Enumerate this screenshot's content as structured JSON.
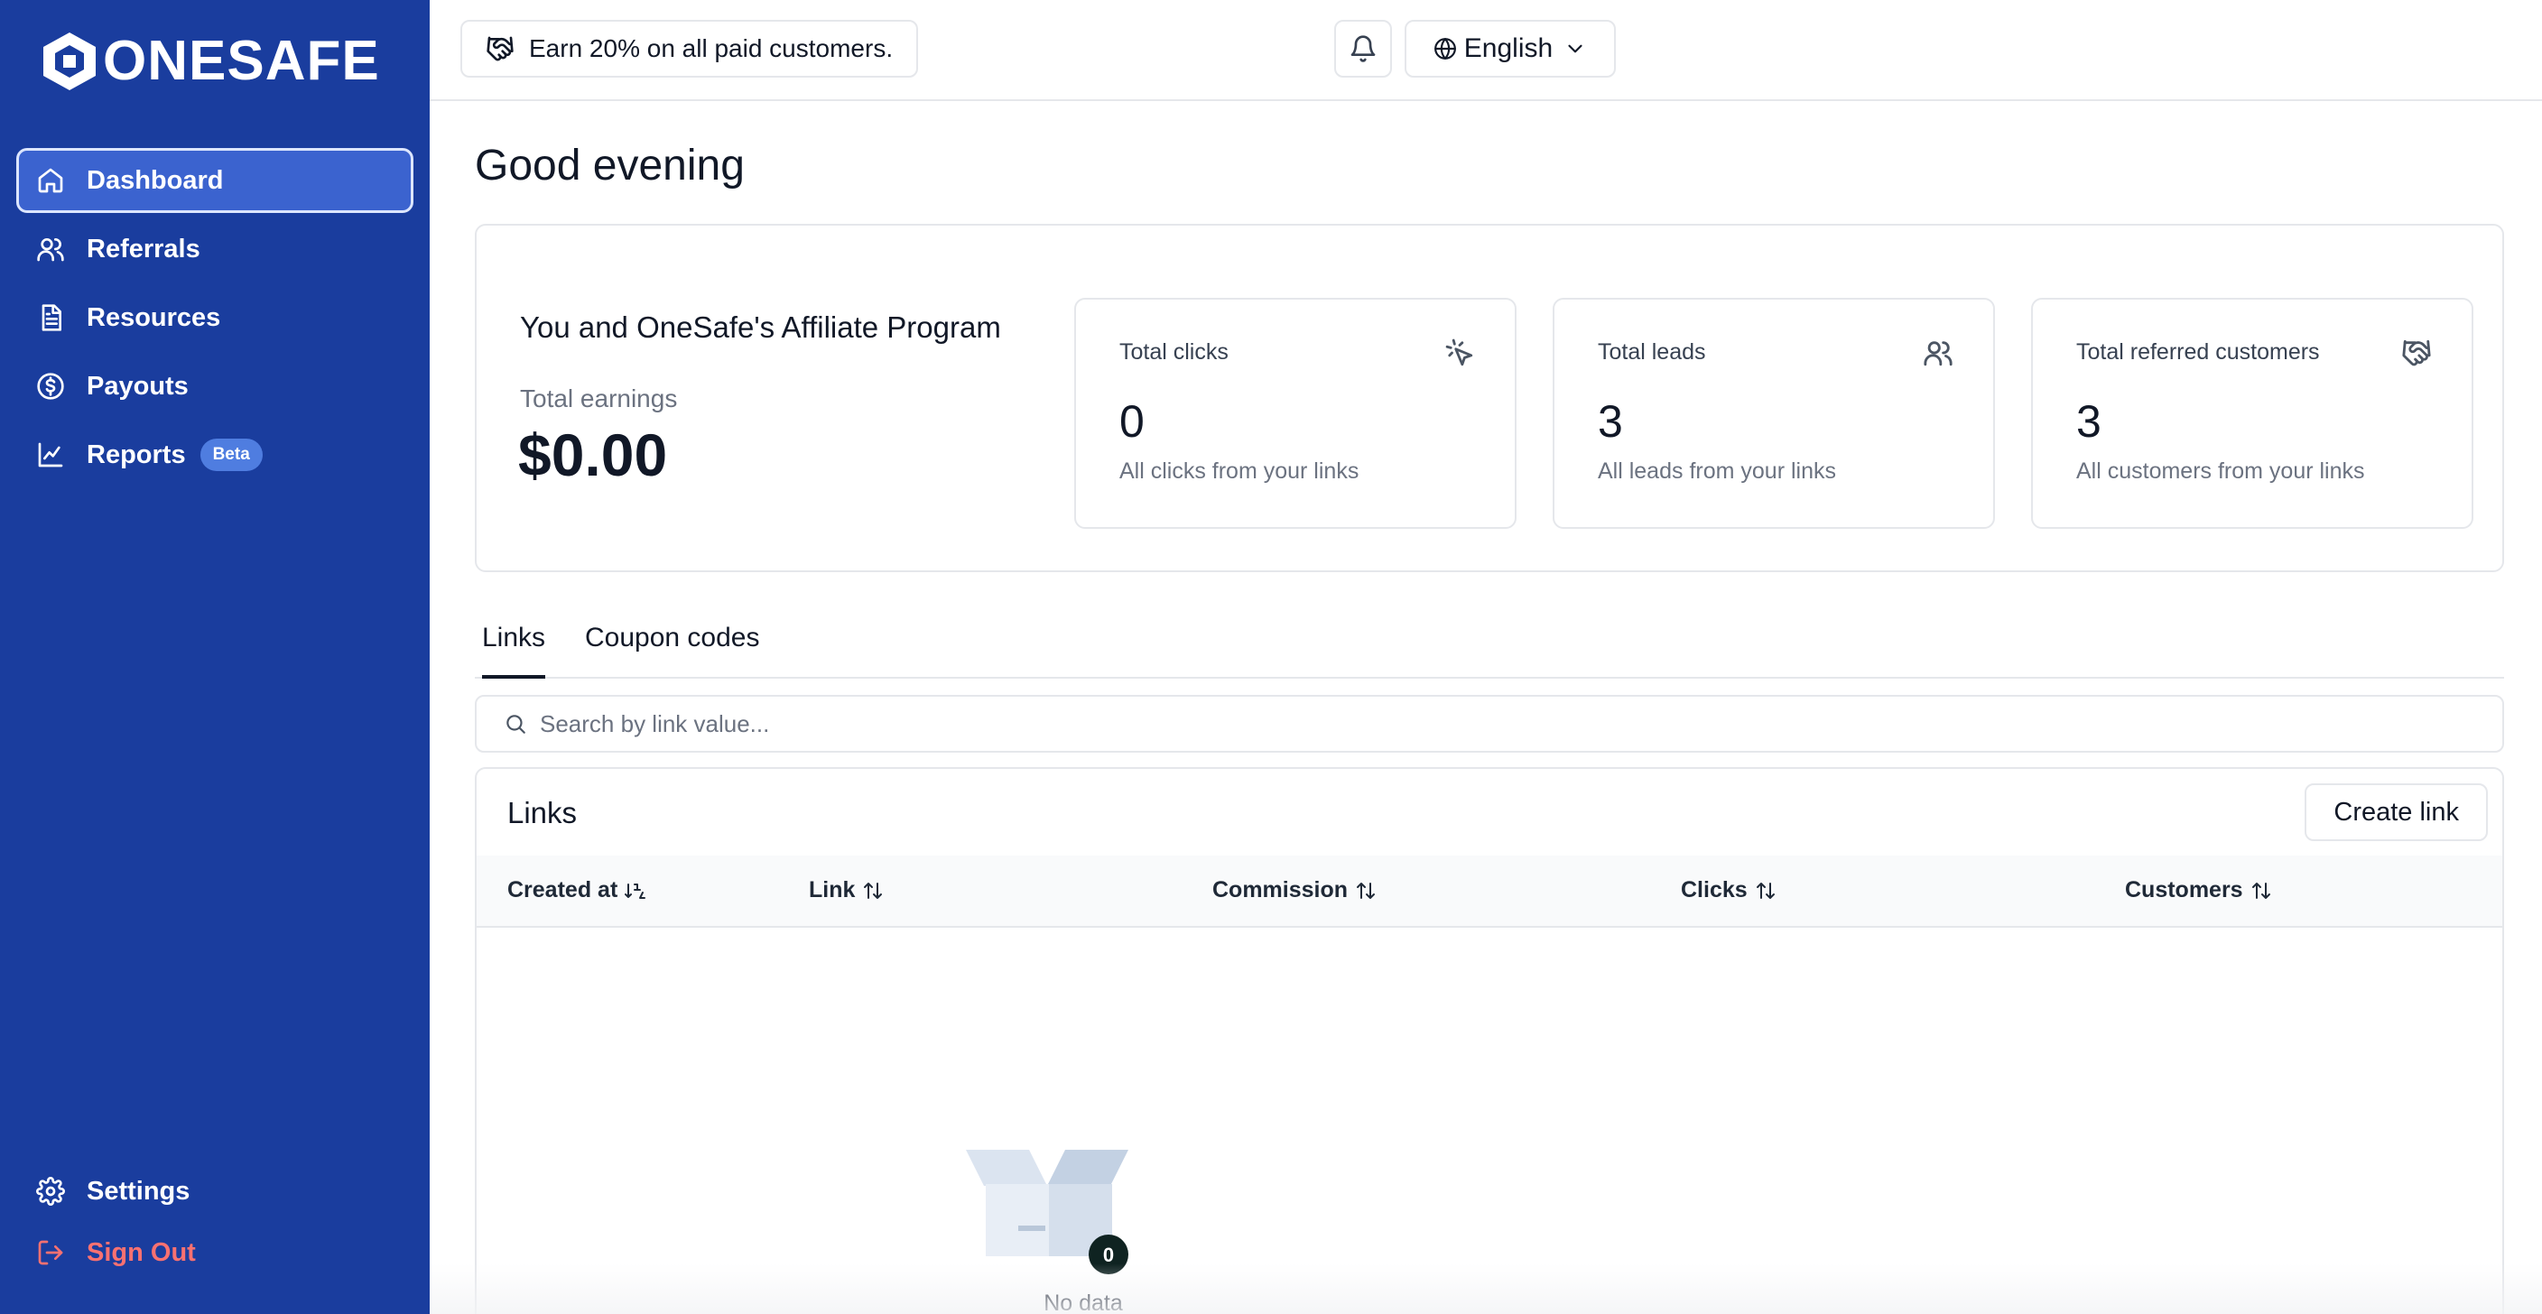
{
  "brand": {
    "name": "ONESAFE"
  },
  "sidebar": {
    "items": [
      {
        "label": "Dashboard",
        "icon": "home-icon",
        "active": true
      },
      {
        "label": "Referrals",
        "icon": "users-icon"
      },
      {
        "label": "Resources",
        "icon": "document-icon"
      },
      {
        "label": "Payouts",
        "icon": "dollar-circle-icon"
      },
      {
        "label": "Reports",
        "icon": "line-chart-icon",
        "badge": "Beta"
      }
    ],
    "bottom": [
      {
        "label": "Settings",
        "icon": "gear-icon"
      },
      {
        "label": "Sign Out",
        "icon": "sign-out-icon"
      }
    ]
  },
  "topbar": {
    "promo": "Earn 20% on all paid customers.",
    "language": "English"
  },
  "main": {
    "greeting": "Good evening",
    "program_title": "You and OneSafe's Affiliate Program",
    "earnings_label": "Total earnings",
    "earnings_value": "$0.00",
    "stats": [
      {
        "label": "Total clicks",
        "value": "0",
        "sub": "All clicks from your links",
        "icon": "cursor-click-icon"
      },
      {
        "label": "Total leads",
        "value": "3",
        "sub": "All leads from your links",
        "icon": "users-icon"
      },
      {
        "label": "Total referred customers",
        "value": "3",
        "sub": "All customers from your links",
        "icon": "handshake-icon"
      }
    ],
    "tabs": [
      "Links",
      "Coupon codes"
    ],
    "search_placeholder": "Search by link value...",
    "table": {
      "title": "Links",
      "create_label": "Create link",
      "columns": [
        "Created at",
        "Link",
        "Commission",
        "Clicks",
        "Customers"
      ],
      "empty_count": "0",
      "empty_text": "No data"
    }
  },
  "colors": {
    "sidebar": "#1a3d9e",
    "active_item": "#3b63cf",
    "sign_out": "#f87171",
    "badge": "#4f7de0"
  }
}
